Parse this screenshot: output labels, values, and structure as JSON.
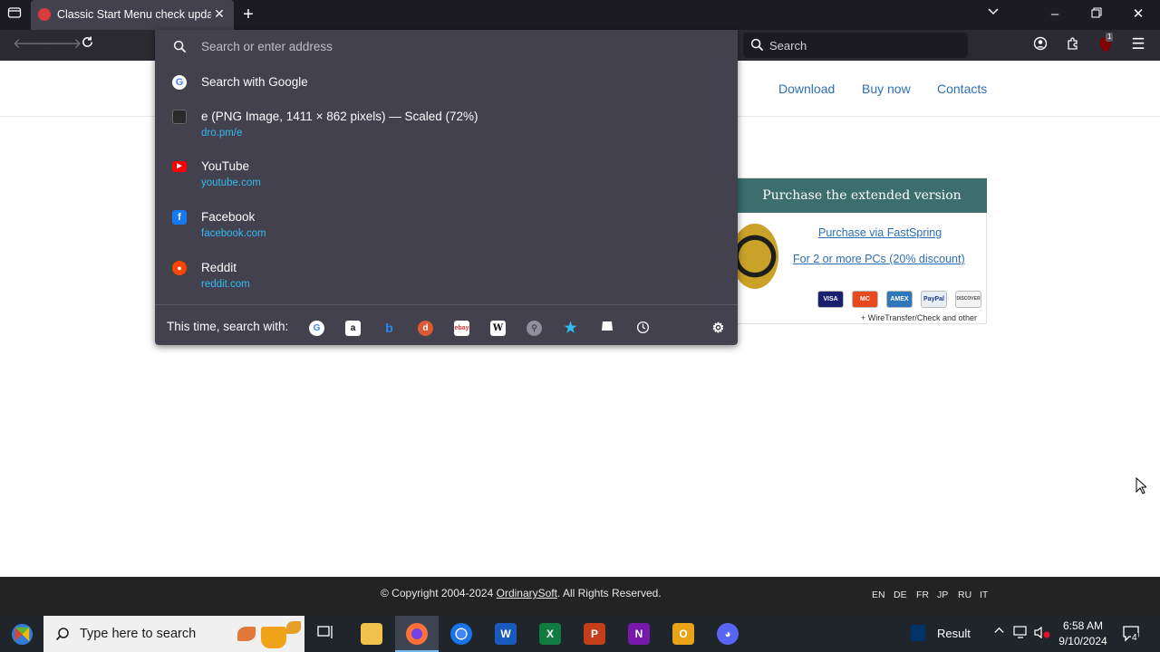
{
  "browser": {
    "tab_title": "Classic Start Menu check updates",
    "search_placeholder": "Search",
    "extension_badge": "1"
  },
  "url_dropdown": {
    "placeholder": "Search or enter address",
    "results": [
      {
        "title": "Search with Google",
        "url": "",
        "icon": "google-icon"
      },
      {
        "title": "e (PNG Image, 1411 × 862 pixels) — Scaled (72%)",
        "url": "dro.pm/e",
        "icon": "image-thumbnail-icon"
      },
      {
        "title": "YouTube",
        "url": "youtube.com",
        "icon": "youtube-icon"
      },
      {
        "title": "Facebook",
        "url": "facebook.com",
        "icon": "facebook-icon"
      },
      {
        "title": "Reddit",
        "url": "reddit.com",
        "icon": "reddit-icon"
      }
    ],
    "one_off_label": "This time, search with:",
    "engines": [
      "google-icon",
      "amazon-icon",
      "bing-icon",
      "duckduckgo-icon",
      "ebay-icon",
      "wikipedia-icon",
      "search-engine-icon",
      "bookmarks-icon",
      "tabs-icon",
      "history-icon",
      "settings-gear-icon"
    ]
  },
  "page": {
    "nav": [
      "Download",
      "Buy now",
      "Contacts"
    ],
    "purchase_title": "Purchase the extended version",
    "purchase_link_1": "Purchase via FastSpring",
    "purchase_link_2": "For 2 or more PCs (20% discount)",
    "cards": [
      "VISA",
      "MC",
      "AMEX",
      "PayPal",
      "DISCOVER"
    ],
    "wire_note": "+ WireTransfer/Check and other",
    "footer_prefix": "© Copyright 2004-2024",
    "footer_link": "OrdinarySoft",
    "footer_suffix": ". All Rights Reserved.",
    "languages": [
      "EN",
      "DE",
      "FR",
      "JP",
      "RU",
      "IT"
    ]
  },
  "taskbar": {
    "search_placeholder": "Type here to search",
    "result_label": "Result",
    "time": "6:58 AM",
    "date": "9/10/2024",
    "notification_count": "4"
  },
  "colors": {
    "chrome_dark": "#1c1b22",
    "panel": "#42414d",
    "link_blue": "#2d6fb5",
    "url_cyan": "#33bbf2",
    "purchase_header": "#3c6e6e"
  }
}
